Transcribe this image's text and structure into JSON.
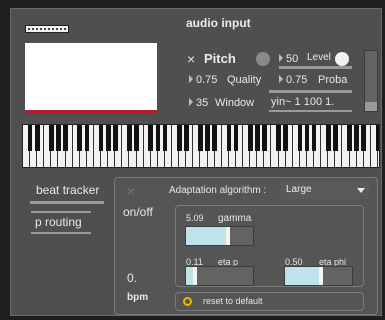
{
  "header": {
    "title": "audio input"
  },
  "pitch": {
    "close_glyph": "×",
    "label": "Pitch",
    "level_value": "50",
    "level_label": "Level",
    "quality_value": "0.75",
    "quality_label": "Quality",
    "proba_value": "0.75",
    "proba_label": "Proba",
    "window_value": "35",
    "window_label": "Window",
    "yin_text": "yin~ 1 100 1."
  },
  "beat": {
    "title": "beat tracker",
    "routing_label": "p routing",
    "onoff_label": "on/off",
    "bpm_value": "0.",
    "bpm_label": "bpm",
    "close_glyph": "×",
    "adapt_label": "Adaptation algorithm :",
    "adapt_selected": "Large",
    "gamma_value": "5.09",
    "gamma_label": "gamma",
    "etap_value": "0.11",
    "etap_label": "eta p",
    "etaphi_value": "0.50",
    "etaphi_label": "eta phi",
    "reset_label": "reset to default"
  },
  "sliders": {
    "gamma_level": 0.6,
    "etap_level": 0.11,
    "etaphi_level": 0.5,
    "vertical_level": 0.15
  },
  "colors": {
    "accent_red": "#b31d2b",
    "slider_fill": "#bfe3ea",
    "led_yellow": "#e4c000"
  }
}
